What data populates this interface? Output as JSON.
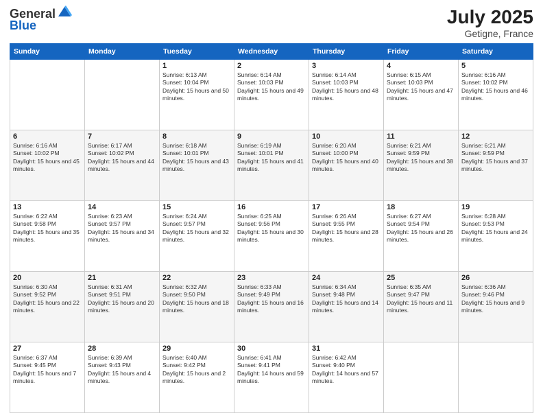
{
  "header": {
    "logo_general": "General",
    "logo_blue": "Blue",
    "month": "July 2025",
    "location": "Getigne, France"
  },
  "weekdays": [
    "Sunday",
    "Monday",
    "Tuesday",
    "Wednesday",
    "Thursday",
    "Friday",
    "Saturday"
  ],
  "weeks": [
    [
      null,
      null,
      {
        "day": "1",
        "sunrise": "Sunrise: 6:13 AM",
        "sunset": "Sunset: 10:04 PM",
        "daylight": "Daylight: 15 hours and 50 minutes."
      },
      {
        "day": "2",
        "sunrise": "Sunrise: 6:14 AM",
        "sunset": "Sunset: 10:03 PM",
        "daylight": "Daylight: 15 hours and 49 minutes."
      },
      {
        "day": "3",
        "sunrise": "Sunrise: 6:14 AM",
        "sunset": "Sunset: 10:03 PM",
        "daylight": "Daylight: 15 hours and 48 minutes."
      },
      {
        "day": "4",
        "sunrise": "Sunrise: 6:15 AM",
        "sunset": "Sunset: 10:03 PM",
        "daylight": "Daylight: 15 hours and 47 minutes."
      },
      {
        "day": "5",
        "sunrise": "Sunrise: 6:16 AM",
        "sunset": "Sunset: 10:02 PM",
        "daylight": "Daylight: 15 hours and 46 minutes."
      }
    ],
    [
      {
        "day": "6",
        "sunrise": "Sunrise: 6:16 AM",
        "sunset": "Sunset: 10:02 PM",
        "daylight": "Daylight: 15 hours and 45 minutes."
      },
      {
        "day": "7",
        "sunrise": "Sunrise: 6:17 AM",
        "sunset": "Sunset: 10:02 PM",
        "daylight": "Daylight: 15 hours and 44 minutes."
      },
      {
        "day": "8",
        "sunrise": "Sunrise: 6:18 AM",
        "sunset": "Sunset: 10:01 PM",
        "daylight": "Daylight: 15 hours and 43 minutes."
      },
      {
        "day": "9",
        "sunrise": "Sunrise: 6:19 AM",
        "sunset": "Sunset: 10:01 PM",
        "daylight": "Daylight: 15 hours and 41 minutes."
      },
      {
        "day": "10",
        "sunrise": "Sunrise: 6:20 AM",
        "sunset": "Sunset: 10:00 PM",
        "daylight": "Daylight: 15 hours and 40 minutes."
      },
      {
        "day": "11",
        "sunrise": "Sunrise: 6:21 AM",
        "sunset": "Sunset: 9:59 PM",
        "daylight": "Daylight: 15 hours and 38 minutes."
      },
      {
        "day": "12",
        "sunrise": "Sunrise: 6:21 AM",
        "sunset": "Sunset: 9:59 PM",
        "daylight": "Daylight: 15 hours and 37 minutes."
      }
    ],
    [
      {
        "day": "13",
        "sunrise": "Sunrise: 6:22 AM",
        "sunset": "Sunset: 9:58 PM",
        "daylight": "Daylight: 15 hours and 35 minutes."
      },
      {
        "day": "14",
        "sunrise": "Sunrise: 6:23 AM",
        "sunset": "Sunset: 9:57 PM",
        "daylight": "Daylight: 15 hours and 34 minutes."
      },
      {
        "day": "15",
        "sunrise": "Sunrise: 6:24 AM",
        "sunset": "Sunset: 9:57 PM",
        "daylight": "Daylight: 15 hours and 32 minutes."
      },
      {
        "day": "16",
        "sunrise": "Sunrise: 6:25 AM",
        "sunset": "Sunset: 9:56 PM",
        "daylight": "Daylight: 15 hours and 30 minutes."
      },
      {
        "day": "17",
        "sunrise": "Sunrise: 6:26 AM",
        "sunset": "Sunset: 9:55 PM",
        "daylight": "Daylight: 15 hours and 28 minutes."
      },
      {
        "day": "18",
        "sunrise": "Sunrise: 6:27 AM",
        "sunset": "Sunset: 9:54 PM",
        "daylight": "Daylight: 15 hours and 26 minutes."
      },
      {
        "day": "19",
        "sunrise": "Sunrise: 6:28 AM",
        "sunset": "Sunset: 9:53 PM",
        "daylight": "Daylight: 15 hours and 24 minutes."
      }
    ],
    [
      {
        "day": "20",
        "sunrise": "Sunrise: 6:30 AM",
        "sunset": "Sunset: 9:52 PM",
        "daylight": "Daylight: 15 hours and 22 minutes."
      },
      {
        "day": "21",
        "sunrise": "Sunrise: 6:31 AM",
        "sunset": "Sunset: 9:51 PM",
        "daylight": "Daylight: 15 hours and 20 minutes."
      },
      {
        "day": "22",
        "sunrise": "Sunrise: 6:32 AM",
        "sunset": "Sunset: 9:50 PM",
        "daylight": "Daylight: 15 hours and 18 minutes."
      },
      {
        "day": "23",
        "sunrise": "Sunrise: 6:33 AM",
        "sunset": "Sunset: 9:49 PM",
        "daylight": "Daylight: 15 hours and 16 minutes."
      },
      {
        "day": "24",
        "sunrise": "Sunrise: 6:34 AM",
        "sunset": "Sunset: 9:48 PM",
        "daylight": "Daylight: 15 hours and 14 minutes."
      },
      {
        "day": "25",
        "sunrise": "Sunrise: 6:35 AM",
        "sunset": "Sunset: 9:47 PM",
        "daylight": "Daylight: 15 hours and 11 minutes."
      },
      {
        "day": "26",
        "sunrise": "Sunrise: 6:36 AM",
        "sunset": "Sunset: 9:46 PM",
        "daylight": "Daylight: 15 hours and 9 minutes."
      }
    ],
    [
      {
        "day": "27",
        "sunrise": "Sunrise: 6:37 AM",
        "sunset": "Sunset: 9:45 PM",
        "daylight": "Daylight: 15 hours and 7 minutes."
      },
      {
        "day": "28",
        "sunrise": "Sunrise: 6:39 AM",
        "sunset": "Sunset: 9:43 PM",
        "daylight": "Daylight: 15 hours and 4 minutes."
      },
      {
        "day": "29",
        "sunrise": "Sunrise: 6:40 AM",
        "sunset": "Sunset: 9:42 PM",
        "daylight": "Daylight: 15 hours and 2 minutes."
      },
      {
        "day": "30",
        "sunrise": "Sunrise: 6:41 AM",
        "sunset": "Sunset: 9:41 PM",
        "daylight": "Daylight: 14 hours and 59 minutes."
      },
      {
        "day": "31",
        "sunrise": "Sunrise: 6:42 AM",
        "sunset": "Sunset: 9:40 PM",
        "daylight": "Daylight: 14 hours and 57 minutes."
      },
      null,
      null
    ]
  ]
}
